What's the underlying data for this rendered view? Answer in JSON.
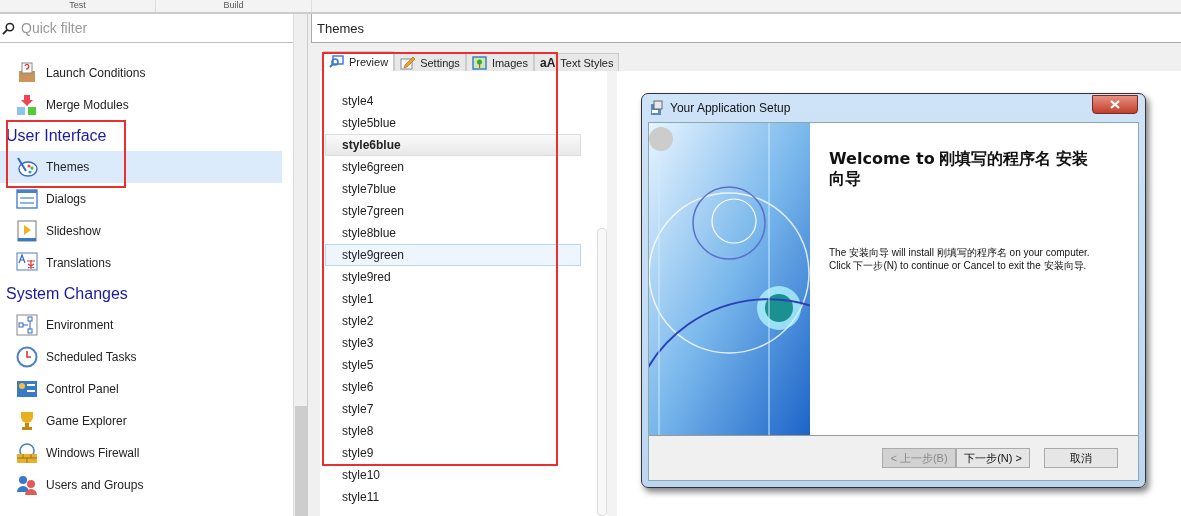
{
  "top_tabs": [
    {
      "label": "Test"
    },
    {
      "label": "Build"
    }
  ],
  "filter": {
    "placeholder": "Quick filter"
  },
  "sidebar": {
    "sections": [
      {
        "items": [
          {
            "label": "Launch Conditions",
            "selected": false
          },
          {
            "label": "Merge Modules",
            "selected": false
          }
        ]
      },
      {
        "title": "User Interface",
        "items": [
          {
            "label": "Themes",
            "selected": true
          },
          {
            "label": "Dialogs",
            "selected": false
          },
          {
            "label": "Slideshow",
            "selected": false
          },
          {
            "label": "Translations",
            "selected": false
          }
        ]
      },
      {
        "title": "System Changes",
        "items": [
          {
            "label": "Environment",
            "selected": false
          },
          {
            "label": "Scheduled Tasks",
            "selected": false
          },
          {
            "label": "Control Panel",
            "selected": false
          },
          {
            "label": "Game Explorer",
            "selected": false
          },
          {
            "label": "Windows Firewall",
            "selected": false
          },
          {
            "label": "Users and Groups",
            "selected": false
          }
        ]
      }
    ]
  },
  "page": {
    "title": "Themes",
    "tabs": [
      {
        "label": "Preview",
        "selected": true
      },
      {
        "label": "Settings",
        "selected": false
      },
      {
        "label": "Images",
        "selected": false
      },
      {
        "label": "Text Styles",
        "selected": false,
        "icon_text": "aA"
      }
    ],
    "themes": [
      {
        "name": "style4",
        "selected": false,
        "hover": false
      },
      {
        "name": "style5blue",
        "selected": false,
        "hover": false
      },
      {
        "name": "style6blue",
        "selected": true,
        "hover": false
      },
      {
        "name": "style6green",
        "selected": false,
        "hover": false
      },
      {
        "name": "style7blue",
        "selected": false,
        "hover": false
      },
      {
        "name": "style7green",
        "selected": false,
        "hover": false
      },
      {
        "name": "style8blue",
        "selected": false,
        "hover": false
      },
      {
        "name": "style9green",
        "selected": false,
        "hover": true
      },
      {
        "name": "style9red",
        "selected": false,
        "hover": false
      },
      {
        "name": "style1",
        "selected": false,
        "hover": false
      },
      {
        "name": "style2",
        "selected": false,
        "hover": false
      },
      {
        "name": "style3",
        "selected": false,
        "hover": false
      },
      {
        "name": "style5",
        "selected": false,
        "hover": false
      },
      {
        "name": "style6",
        "selected": false,
        "hover": false
      },
      {
        "name": "style7",
        "selected": false,
        "hover": false
      },
      {
        "name": "style8",
        "selected": false,
        "hover": false
      },
      {
        "name": "style9",
        "selected": false,
        "hover": false
      },
      {
        "name": "style10",
        "selected": false,
        "hover": false
      },
      {
        "name": "style11",
        "selected": false,
        "hover": false
      }
    ]
  },
  "dialog": {
    "title": "Your Application Setup",
    "heading": "**Welcome to** 刚填写的程序名 安装向导",
    "body": "The 安装向导 will install 刚填写的程序名 on your computer. Click 下一步(N) to continue or Cancel to exit the 安装向导.",
    "buttons": [
      {
        "label": "< 上一步(B)",
        "disabled": true
      },
      {
        "label": "下一步(N) >",
        "disabled": false
      },
      {
        "label": "取消",
        "disabled": false
      }
    ]
  }
}
